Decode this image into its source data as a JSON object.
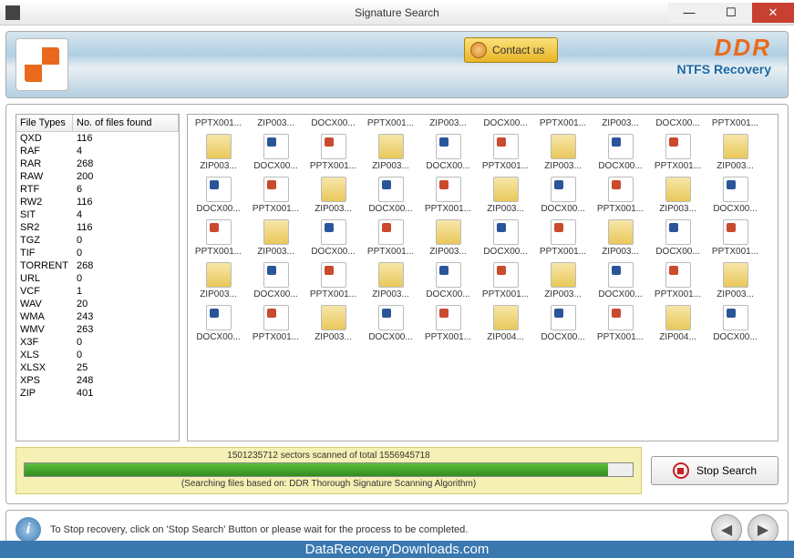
{
  "window": {
    "title": "Signature Search"
  },
  "header": {
    "contact_label": "Contact us",
    "brand": "DDR",
    "subtitle": "NTFS Recovery"
  },
  "filetypes": {
    "headers": {
      "c1": "File Types",
      "c2": "No. of files found"
    },
    "rows": [
      {
        "t": "QXD",
        "n": "116"
      },
      {
        "t": "RAF",
        "n": "4"
      },
      {
        "t": "RAR",
        "n": "268"
      },
      {
        "t": "RAW",
        "n": "200"
      },
      {
        "t": "RTF",
        "n": "6"
      },
      {
        "t": "RW2",
        "n": "116"
      },
      {
        "t": "SIT",
        "n": "4"
      },
      {
        "t": "SR2",
        "n": "116"
      },
      {
        "t": "TGZ",
        "n": "0"
      },
      {
        "t": "TIF",
        "n": "0"
      },
      {
        "t": "TORRENT",
        "n": "268"
      },
      {
        "t": "URL",
        "n": "0"
      },
      {
        "t": "VCF",
        "n": "1"
      },
      {
        "t": "WAV",
        "n": "20"
      },
      {
        "t": "WMA",
        "n": "243"
      },
      {
        "t": "WMV",
        "n": "263"
      },
      {
        "t": "X3F",
        "n": "0"
      },
      {
        "t": "XLS",
        "n": "0"
      },
      {
        "t": "XLSX",
        "n": "25"
      },
      {
        "t": "XPS",
        "n": "248"
      },
      {
        "t": "ZIP",
        "n": "401"
      }
    ]
  },
  "grid": {
    "row0": [
      "PPTX001...",
      "ZIP003...",
      "DOCX00...",
      "PPTX001...",
      "ZIP003...",
      "DOCX00...",
      "PPTX001...",
      "ZIP003...",
      "DOCX00...",
      "PPTX001..."
    ],
    "rows": [
      [
        {
          "l": "ZIP003...",
          "i": "zip"
        },
        {
          "l": "DOCX00...",
          "i": "docx"
        },
        {
          "l": "PPTX001...",
          "i": "pptx"
        },
        {
          "l": "ZIP003...",
          "i": "zip"
        },
        {
          "l": "DOCX00...",
          "i": "docx"
        },
        {
          "l": "PPTX001...",
          "i": "pptx"
        },
        {
          "l": "ZIP003...",
          "i": "zip"
        },
        {
          "l": "DOCX00...",
          "i": "docx"
        },
        {
          "l": "PPTX001...",
          "i": "pptx"
        },
        {
          "l": "ZIP003...",
          "i": "zip"
        }
      ],
      [
        {
          "l": "DOCX00...",
          "i": "docx"
        },
        {
          "l": "PPTX001...",
          "i": "pptx"
        },
        {
          "l": "ZIP003...",
          "i": "zip"
        },
        {
          "l": "DOCX00...",
          "i": "docx"
        },
        {
          "l": "PPTX001...",
          "i": "pptx"
        },
        {
          "l": "ZIP003...",
          "i": "zip"
        },
        {
          "l": "DOCX00...",
          "i": "docx"
        },
        {
          "l": "PPTX001...",
          "i": "pptx"
        },
        {
          "l": "ZIP003...",
          "i": "zip"
        },
        {
          "l": "DOCX00...",
          "i": "docx"
        }
      ],
      [
        {
          "l": "PPTX001...",
          "i": "pptx"
        },
        {
          "l": "ZIP003...",
          "i": "zip"
        },
        {
          "l": "DOCX00...",
          "i": "docx"
        },
        {
          "l": "PPTX001...",
          "i": "pptx"
        },
        {
          "l": "ZIP003...",
          "i": "zip"
        },
        {
          "l": "DOCX00...",
          "i": "docx"
        },
        {
          "l": "PPTX001...",
          "i": "pptx"
        },
        {
          "l": "ZIP003...",
          "i": "zip"
        },
        {
          "l": "DOCX00...",
          "i": "docx"
        },
        {
          "l": "PPTX001...",
          "i": "pptx"
        }
      ],
      [
        {
          "l": "ZIP003...",
          "i": "zip"
        },
        {
          "l": "DOCX00...",
          "i": "docx"
        },
        {
          "l": "PPTX001...",
          "i": "pptx"
        },
        {
          "l": "ZIP003...",
          "i": "zip"
        },
        {
          "l": "DOCX00...",
          "i": "docx"
        },
        {
          "l": "PPTX001...",
          "i": "pptx"
        },
        {
          "l": "ZIP003...",
          "i": "zip"
        },
        {
          "l": "DOCX00...",
          "i": "docx"
        },
        {
          "l": "PPTX001...",
          "i": "pptx"
        },
        {
          "l": "ZIP003...",
          "i": "zip"
        }
      ],
      [
        {
          "l": "DOCX00...",
          "i": "docx"
        },
        {
          "l": "PPTX001...",
          "i": "pptx"
        },
        {
          "l": "ZIP003...",
          "i": "zip"
        },
        {
          "l": "DOCX00...",
          "i": "docx"
        },
        {
          "l": "PPTX001...",
          "i": "pptx"
        },
        {
          "l": "ZIP004...",
          "i": "zip"
        },
        {
          "l": "DOCX00...",
          "i": "docx"
        },
        {
          "l": "PPTX001...",
          "i": "pptx"
        },
        {
          "l": "ZIP004...",
          "i": "zip"
        },
        {
          "l": "DOCX00...",
          "i": "docx"
        }
      ]
    ]
  },
  "progress": {
    "text": "1501235712 sectors scanned of total 1556945718",
    "percent": 96,
    "sub": "(Searching files based on:  DDR Thorough Signature Scanning Algorithm)"
  },
  "stop_label": "Stop Search",
  "footer": {
    "info": "To Stop recovery, click on 'Stop Search' Button or please wait for the process to be completed."
  },
  "watermark": "DataRecoveryDownloads.com"
}
